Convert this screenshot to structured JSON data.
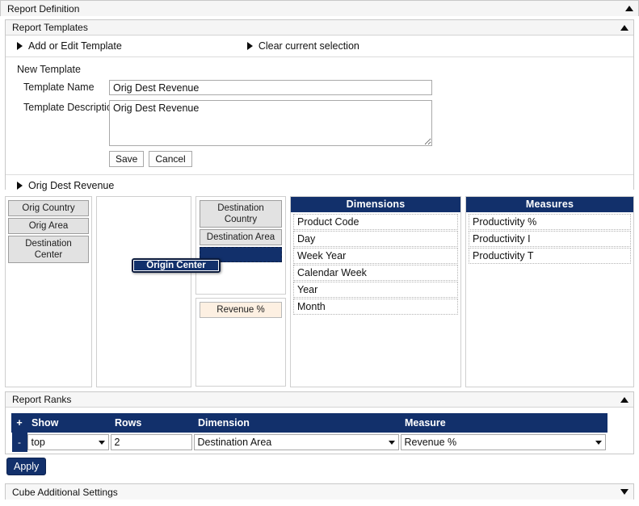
{
  "report_definition": {
    "title": "Report Definition",
    "collapse_icon": "triangle-up-icon"
  },
  "report_templates": {
    "title": "Report Templates",
    "collapse_icon": "triangle-up-icon",
    "links": [
      {
        "label": "Add or Edit Template",
        "icon": "triangle-right-icon"
      },
      {
        "label": "Clear current selection",
        "icon": "triangle-right-icon"
      }
    ],
    "new_template_label": "New Template",
    "fields": {
      "name_label": "Template Name",
      "name_value": "Orig Dest Revenue",
      "description_label": "Template Description",
      "description_value": "Orig Dest Revenue"
    },
    "buttons": {
      "save": "Save",
      "cancel": "Cancel"
    },
    "saved_template": {
      "label": "Orig Dest Revenue",
      "icon": "triangle-right-icon"
    }
  },
  "builder": {
    "sources": [
      {
        "label": "Orig Country"
      },
      {
        "label": "Orig Area"
      },
      {
        "label": "Destination Center"
      }
    ],
    "rows_panel": {
      "items": []
    },
    "target": {
      "dimension_chips": [
        {
          "label": "Destination Country"
        },
        {
          "label": "Destination Area"
        }
      ],
      "drop_placeholder": "",
      "measure_chips": [
        {
          "label": "Revenue %"
        }
      ]
    },
    "dragging_chip": {
      "label": "Origin Center"
    },
    "dimensions": {
      "header": "Dimensions",
      "items": [
        {
          "label": "Product Code"
        },
        {
          "label": "Day"
        },
        {
          "label": "Week Year"
        },
        {
          "label": "Calendar Week"
        },
        {
          "label": "Year"
        },
        {
          "label": "Month"
        }
      ]
    },
    "measures": {
      "header": "Measures",
      "items": [
        {
          "label": "Productivity %"
        },
        {
          "label": "Productivity I"
        },
        {
          "label": "Productivity T"
        }
      ]
    }
  },
  "report_ranks": {
    "title": "Report Ranks",
    "collapse_icon": "triangle-up-icon",
    "add_row_label": "+",
    "remove_row_label": "-",
    "columns": [
      "Show",
      "Rows",
      "Dimension",
      "Measure"
    ],
    "rows": [
      {
        "show": "top",
        "rows": "2",
        "dimension": "Destination Area",
        "measure": "Revenue %"
      }
    ]
  },
  "apply_button": {
    "label": "Apply"
  },
  "cube_settings": {
    "title": "Cube Additional Settings",
    "expand_icon": "triangle-down-icon"
  },
  "colors": {
    "navy": "#12306b",
    "panel_head": "#f5f5f5",
    "chip_gray": "#e2e2e2",
    "chip_measure": "#fdf0e2"
  }
}
